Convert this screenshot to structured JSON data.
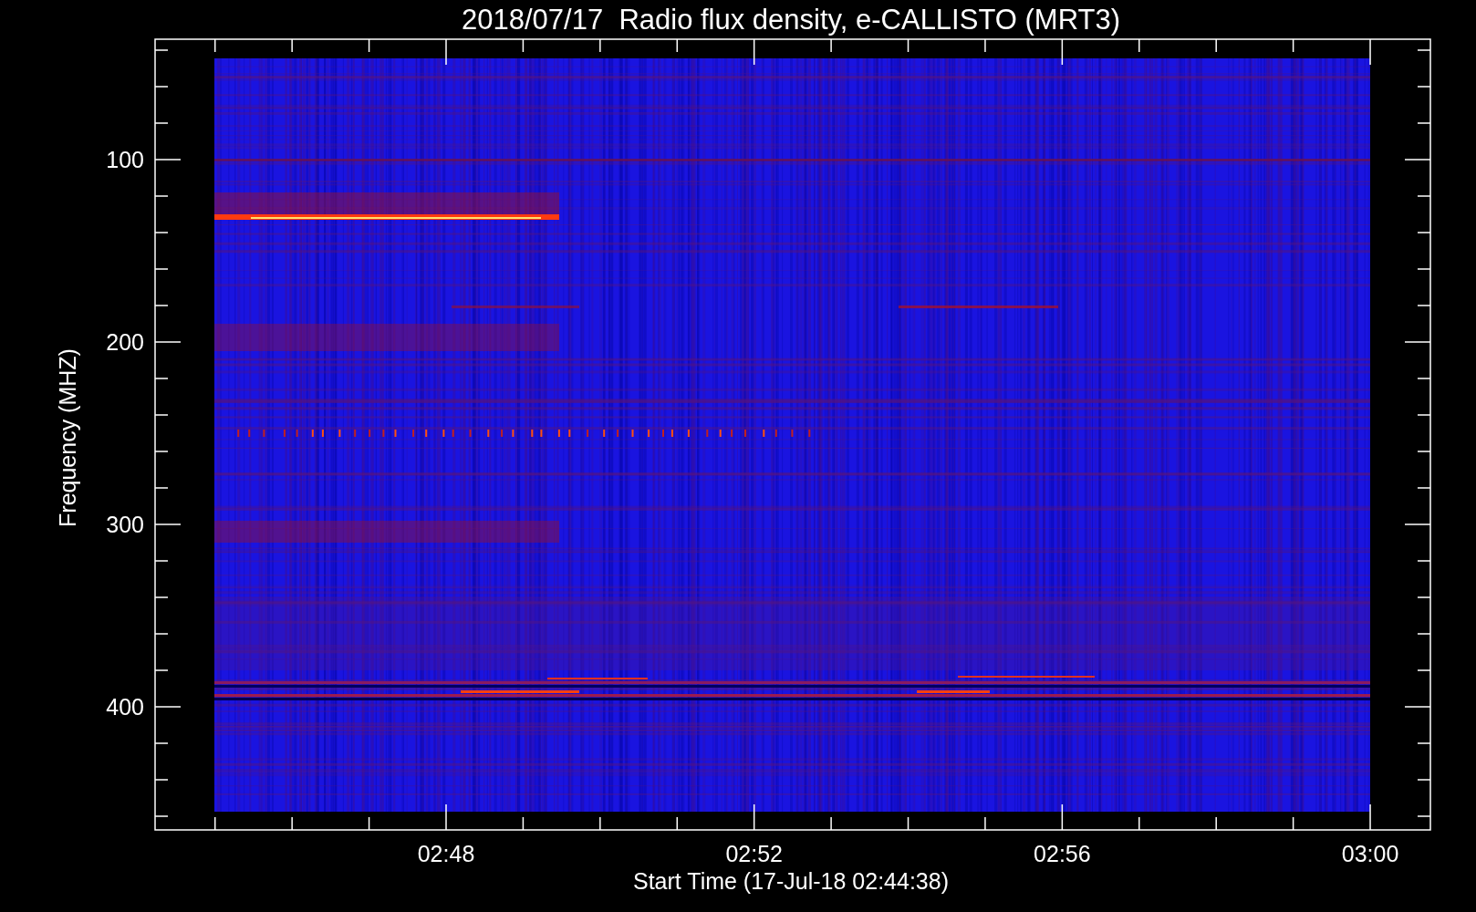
{
  "title": "2018/07/17  Radio flux density, e-CALLISTO (MRT3)",
  "y_axis": {
    "label": "Frequency (MHZ)",
    "ticks": [
      "100",
      "200",
      "300",
      "400"
    ]
  },
  "x_axis": {
    "label": "Start Time (17-Jul-18 02:44:38)",
    "ticks": [
      "02:48",
      "02:52",
      "02:56",
      "03:00"
    ]
  }
}
